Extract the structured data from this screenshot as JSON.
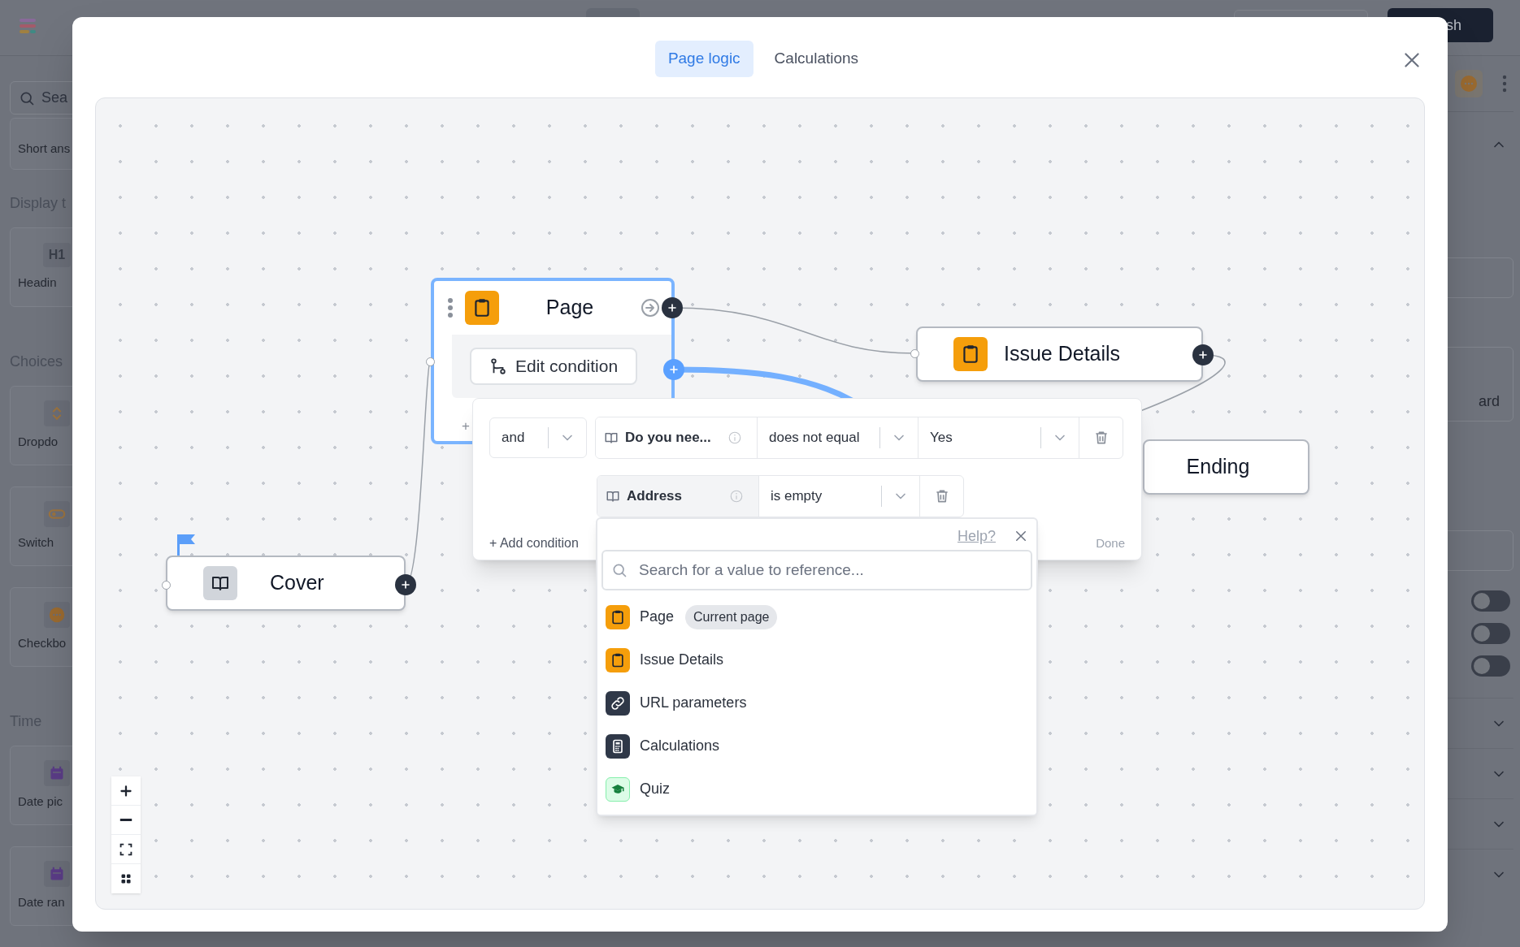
{
  "app": {
    "search_placeholder": "Sea",
    "publish_button": "sh",
    "sidebar_sections": [
      {
        "items": [
          {
            "label": "Short ans",
            "kind": "plain"
          }
        ]
      },
      {
        "heading": "Display t",
        "items": [
          {
            "label": "Headin",
            "kind": "heading",
            "glyph": "H1"
          }
        ]
      },
      {
        "heading": "Choices",
        "items": [
          {
            "label": "Dropdo",
            "kind": "dropdown"
          },
          {
            "label": "Switch",
            "kind": "switch"
          },
          {
            "label": "Checkbo",
            "kind": "checkbox"
          }
        ]
      },
      {
        "heading": "Time",
        "items": [
          {
            "label": "Date pic",
            "kind": "date"
          },
          {
            "label": "Date ran",
            "kind": "date"
          }
        ]
      }
    ],
    "right_panel": {
      "card_label": "ard",
      "toggles": [
        {
          "on": false
        },
        {
          "on": false
        },
        {
          "on": false
        }
      ]
    }
  },
  "modal": {
    "tabs": [
      {
        "label": "Page logic",
        "selected": true
      },
      {
        "label": "Calculations",
        "selected": false
      }
    ],
    "canvas": {
      "nodes": [
        {
          "title": "Page",
          "kind": "page",
          "selected": true,
          "edit_button": "Edit condition",
          "add_glyph": "+"
        },
        {
          "title": "Issue Details",
          "kind": "page",
          "selected": false
        },
        {
          "title": "Ending",
          "kind": "ending",
          "selected": false
        },
        {
          "title": "Cover",
          "kind": "cover",
          "selected": false,
          "start": true
        }
      ],
      "condition_editor": {
        "conditions": [
          {
            "connector": "and",
            "field": "Do you nee...",
            "operator": "does not equal",
            "value": "Yes",
            "active": false
          },
          {
            "field": "Address",
            "operator": "is empty",
            "active": true
          }
        ],
        "add_label": "+ Add condition",
        "done_label": "Done"
      },
      "reference_picker": {
        "help_link": "Help?",
        "search_placeholder": "Search for a value to reference...",
        "items": [
          {
            "label": "Page",
            "kind": "page",
            "badge": "Current page"
          },
          {
            "label": "Issue Details",
            "kind": "page"
          },
          {
            "label": "URL parameters",
            "kind": "url"
          },
          {
            "label": "Calculations",
            "kind": "calculation"
          },
          {
            "label": "Quiz",
            "kind": "quiz"
          }
        ]
      }
    }
  }
}
